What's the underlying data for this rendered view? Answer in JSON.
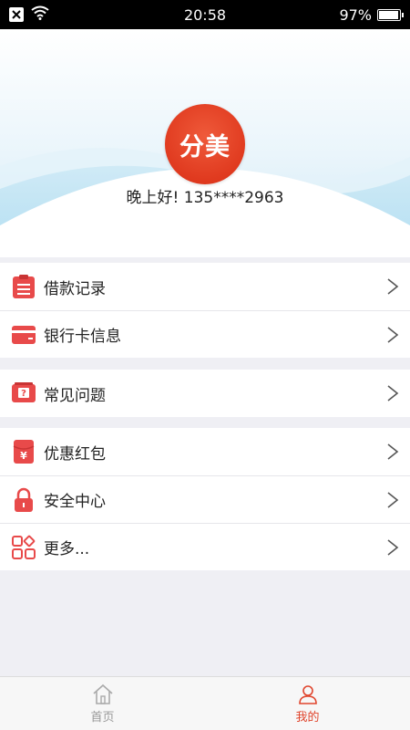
{
  "status_bar": {
    "time": "20:58",
    "battery": "97%",
    "battery_level": 0.97,
    "icons": [
      "close-box-icon",
      "wifi-icon",
      "battery-icon"
    ]
  },
  "header": {
    "logo_text": "分美",
    "greeting": "晚上好! 135****2963"
  },
  "menu": {
    "group1": [
      {
        "label": "借款记录",
        "icon": "clipboard-icon"
      },
      {
        "label": "银行卡信息",
        "icon": "bank-card-icon"
      }
    ],
    "group2": [
      {
        "label": "常见问题",
        "icon": "question-icon"
      }
    ],
    "group3": [
      {
        "label": "优惠红包",
        "icon": "red-envelope-icon"
      },
      {
        "label": "安全中心",
        "icon": "lock-icon"
      },
      {
        "label": "更多...",
        "icon": "grid-more-icon"
      }
    ]
  },
  "tabbar": {
    "home": "首页",
    "mine": "我的",
    "active": "mine"
  },
  "colors": {
    "accent": "#e0452d",
    "icon_red": "#e84a4a",
    "background": "#efeff4"
  }
}
